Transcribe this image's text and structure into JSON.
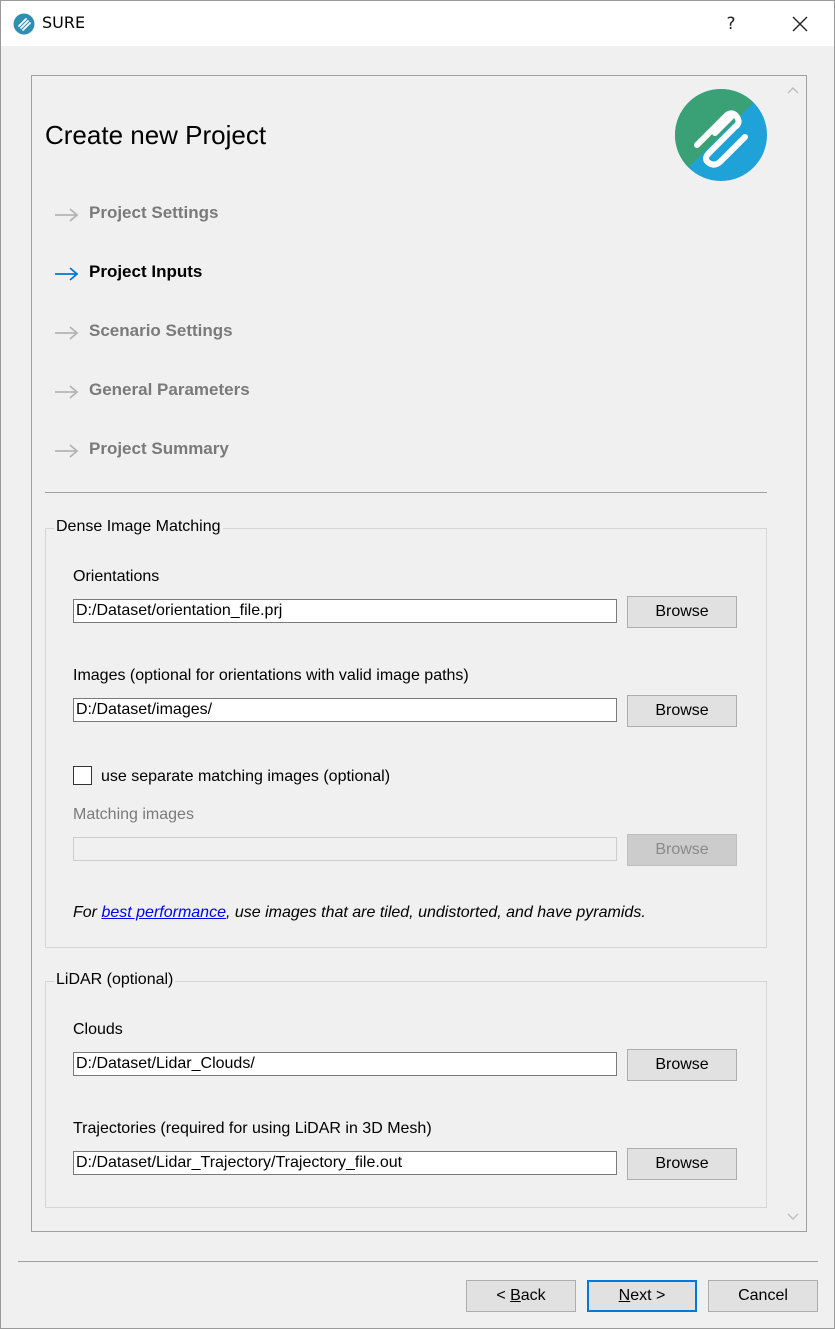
{
  "window": {
    "title": "SURE",
    "help": "?"
  },
  "page": {
    "title": "Create new Project"
  },
  "steps": [
    {
      "label": "Project Settings",
      "state": "inactive"
    },
    {
      "label": "Project Inputs",
      "state": "active"
    },
    {
      "label": "Scenario Settings",
      "state": "inactive"
    },
    {
      "label": "General Parameters",
      "state": "inactive"
    },
    {
      "label": "Project Summary",
      "state": "inactive"
    }
  ],
  "dense": {
    "title": "Dense Image Matching",
    "orientations_label": "Orientations",
    "orientations_value": "D:/Dataset/orientation_file.prj",
    "images_label": "Images (optional for orientations with valid image paths)",
    "images_value": "D:/Dataset/images/",
    "separate_label": "use separate matching images (optional)",
    "separate_checked": false,
    "matching_label": "Matching images",
    "matching_value": "",
    "browse": "Browse",
    "note_prefix": "For ",
    "note_link": "best performance",
    "note_suffix": ", use images that are tiled, undistorted, and have pyramids."
  },
  "lidar": {
    "title": "LiDAR (optional)",
    "clouds_label": "Clouds",
    "clouds_value": "D:/Dataset/Lidar_Clouds/",
    "traj_label": "Trajectories (required for using LiDAR in 3D Mesh)",
    "traj_value": "D:/Dataset/Lidar_Trajectory/Trajectory_file.out",
    "browse": "Browse"
  },
  "nav": {
    "back_prefix": "< ",
    "back_key": "B",
    "back_rest": "ack",
    "next_key": "N",
    "next_rest": "ext >",
    "cancel": "Cancel"
  },
  "colors": {
    "active_arrow": "#0078d7",
    "inactive_arrow": "#b4b4b4",
    "logo_green": "#3aa176",
    "logo_blue": "#1ea2d8"
  }
}
